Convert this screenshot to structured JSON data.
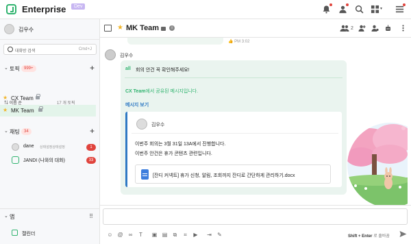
{
  "topbar": {
    "brand": "Enterprise",
    "env_badge": "Dev",
    "icons": [
      "bell-icon",
      "team-icon",
      "search-icon",
      "apps-grid-icon",
      "menu-icon"
    ]
  },
  "sidebar": {
    "user_name": "김우수",
    "search": {
      "placeholder": "대화방 검색",
      "shortcut": "Cmd+J"
    },
    "topics": {
      "title": "토픽",
      "badge": "999+",
      "sort_label": "이름 순",
      "count_label": "17 개 토픽",
      "items": [
        {
          "label": "CX Team",
          "starred": true,
          "locked": true,
          "selected": false
        },
        {
          "label": "MK Team",
          "starred": true,
          "locked": true,
          "selected": true
        }
      ]
    },
    "chats": {
      "title": "채팅",
      "badge": "34",
      "items": [
        {
          "label": "dane",
          "status": "상태설정상태설정",
          "unread": "1"
        },
        {
          "label": "JANDI (나와의 대화)",
          "unread": "33"
        }
      ]
    },
    "apps": {
      "title": "앱",
      "items": [
        {
          "label": "캘린더"
        }
      ]
    }
  },
  "header": {
    "title": "MK Team",
    "member_count": "2"
  },
  "messages": {
    "prev_time": "PM 3:02",
    "message": {
      "author": "김우수",
      "mention": "all",
      "text": "회의 안건 꼭 확인해주세요!",
      "share_topic": "CX Team",
      "share_text": "에서 공유된 메시지입니다.",
      "view_label": "메시지 보기",
      "quote": {
        "author": "김우수",
        "line1": "이번주 회의는 3월 31일 13A에서 진행합니다.",
        "line2": "이번주 안건은 휴가 콘텐츠 관련입니다.",
        "file_name": "[잔디 커넥트] 휴가 신청, 알림, 조회까지 잔디로 간단하게 관리하기.docx"
      }
    }
  },
  "composer": {
    "placeholder": "",
    "hint_keys": "Shift + Enter",
    "hint_text": "로 줄바꿈",
    "tools": [
      "emoji-icon",
      "mention-icon",
      "link-icon",
      "text-format-icon",
      "attach-file-icon",
      "image-icon",
      "code-icon",
      "screenshot-icon",
      "video-icon",
      "folder-icon",
      "connect-icon",
      "sticker-icon"
    ]
  },
  "colors": {
    "accent": "#2fb36e",
    "link": "#2f79c4",
    "alert": "#e0433c",
    "bubble": "#eaf4ef"
  }
}
